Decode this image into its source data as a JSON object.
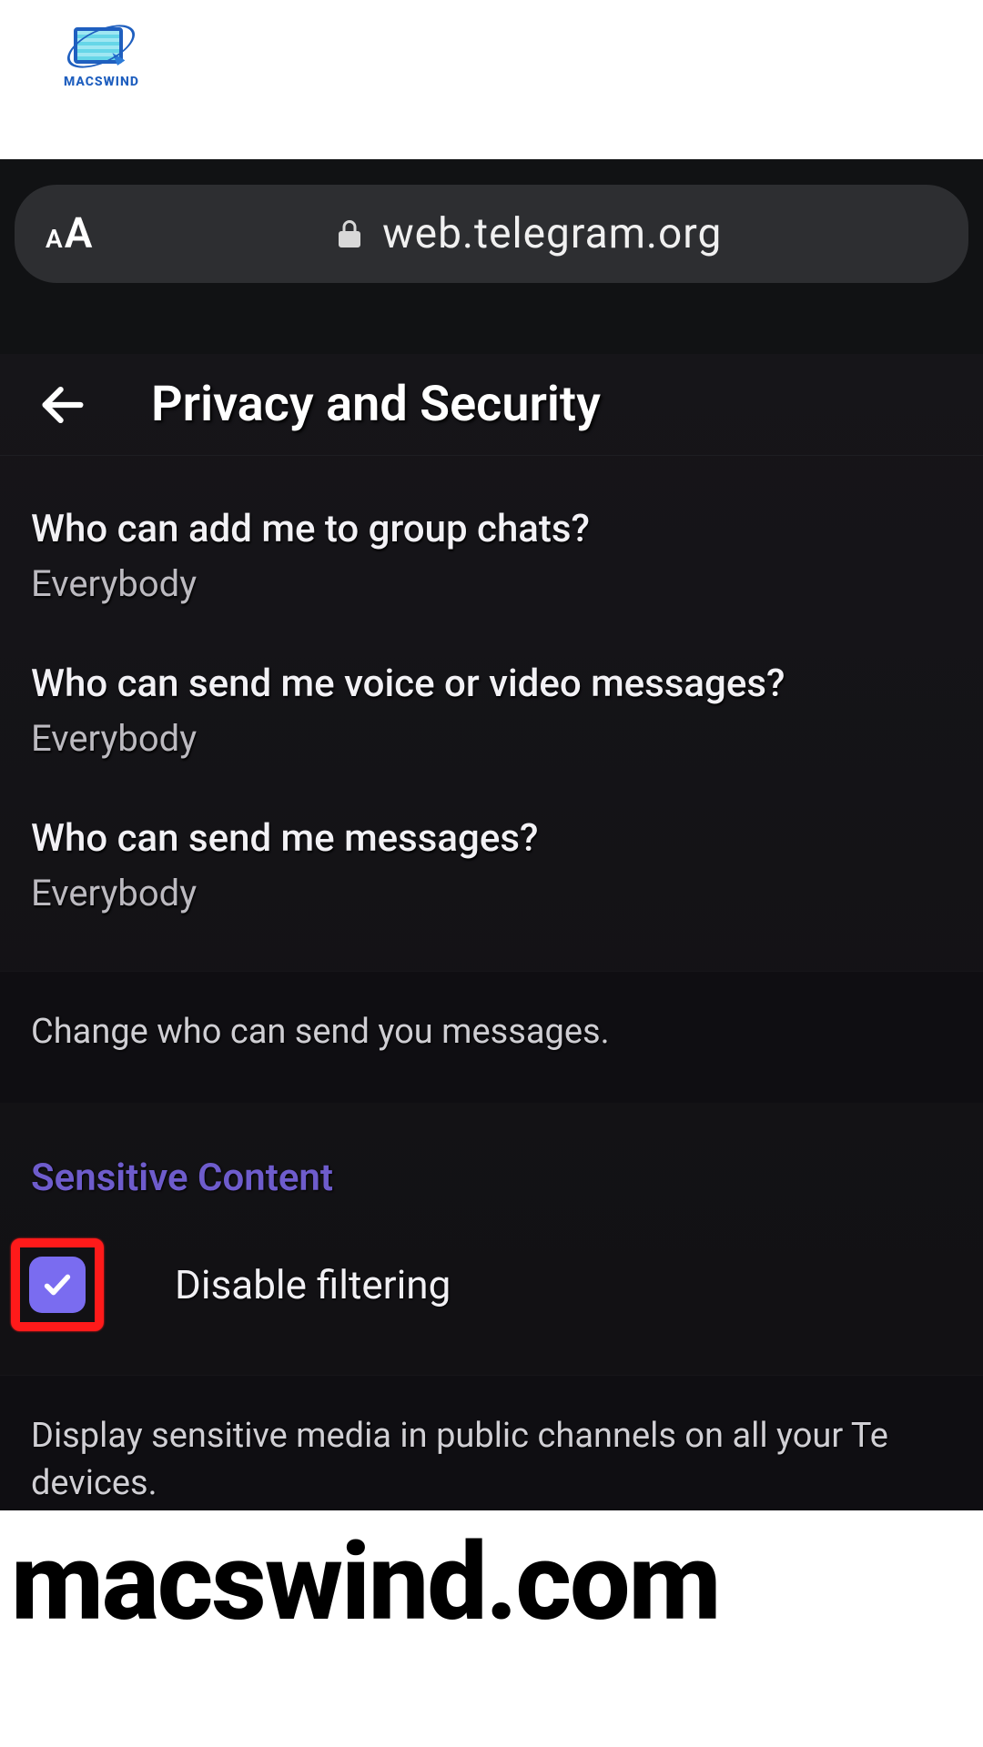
{
  "logo": {
    "text": "MACSWIND"
  },
  "browser": {
    "font_button_smallA": "A",
    "font_button_bigA": "A",
    "host": "web.telegram.org"
  },
  "page": {
    "title": "Privacy and Security",
    "settings": [
      {
        "title": "Who can add me to group chats?",
        "value": "Everybody"
      },
      {
        "title": "Who can send me voice or video messages?",
        "value": "Everybody"
      },
      {
        "title": "Who can send me messages?",
        "value": "Everybody"
      }
    ],
    "messages_note": "Change who can send you messages.",
    "sensitive_header": "Sensitive Content",
    "disable_filtering_label": "Disable filtering",
    "sensitive_desc": "Display sensitive media in public channels on all your Te devices."
  },
  "footer": {
    "brand": "macswind.com"
  }
}
